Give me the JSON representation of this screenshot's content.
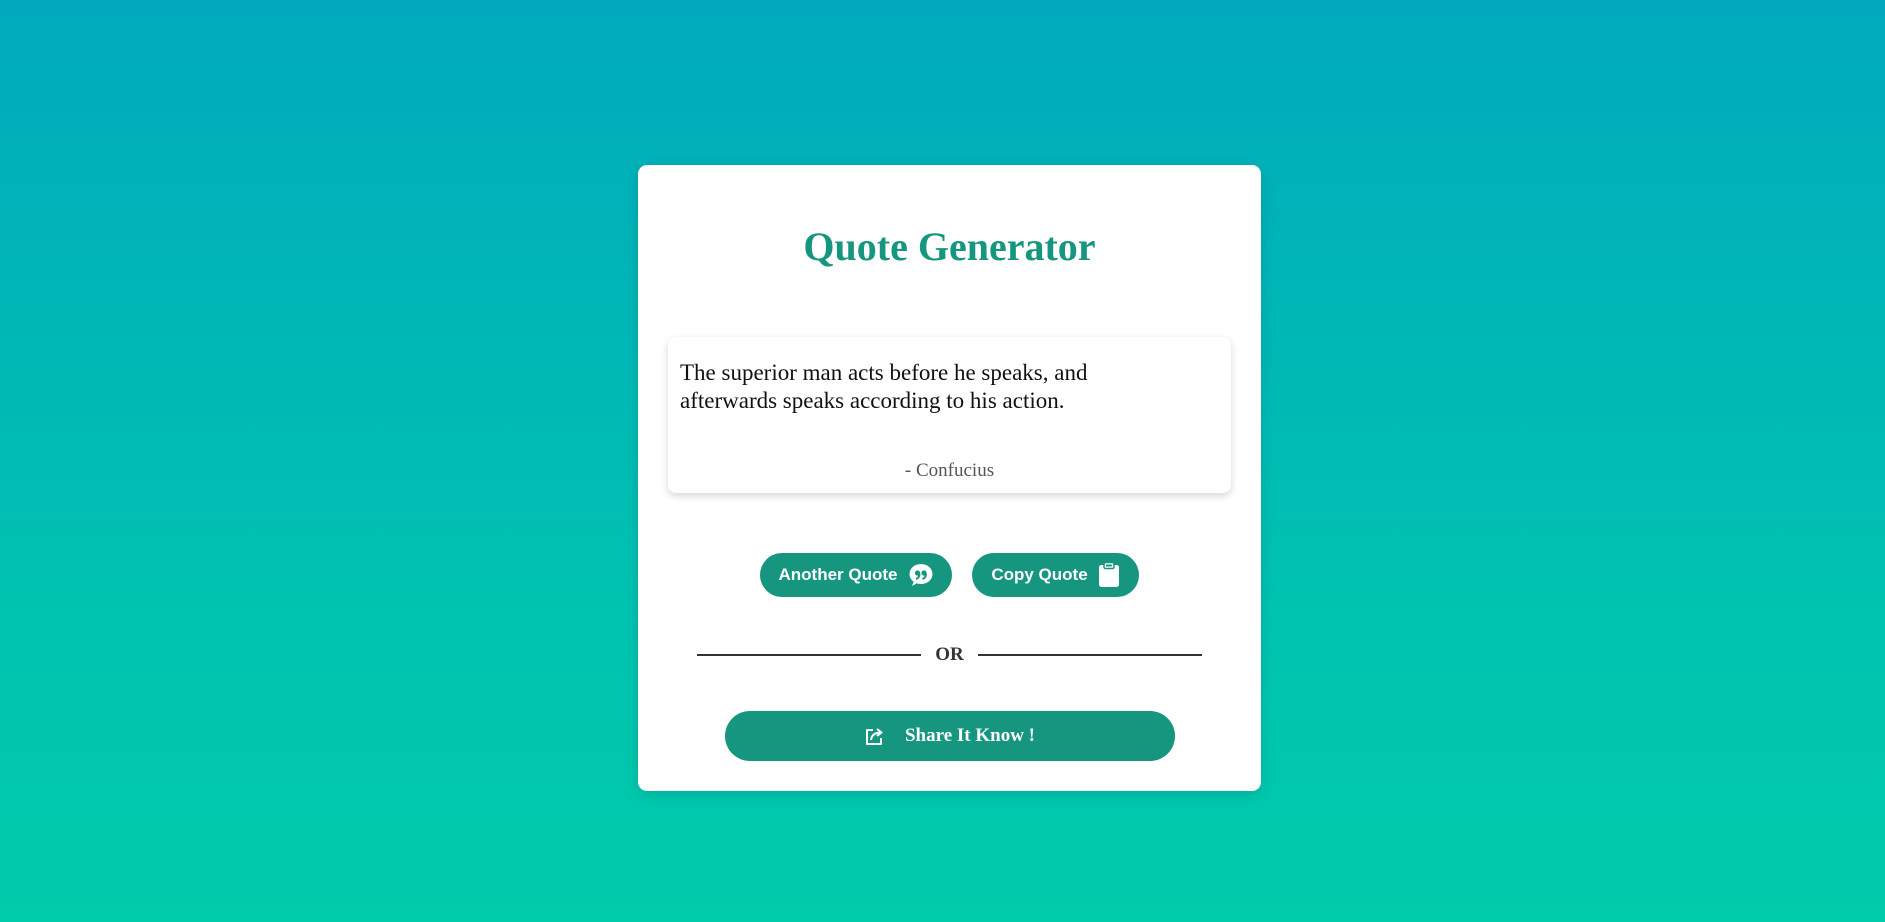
{
  "app": {
    "title": "Quote Generator"
  },
  "quote": {
    "text": "The superior man acts before he speaks, and afterwards speaks according to his action.",
    "author": "- Confucius"
  },
  "actions": {
    "another_quote_label": "Another Quote",
    "another_quote_icon": "quote-bubble-icon",
    "copy_quote_label": "Copy Quote",
    "copy_quote_icon": "clipboard-icon"
  },
  "divider": {
    "label": "OR"
  },
  "share": {
    "label": "Share It Know !",
    "icon": "share-icon"
  },
  "colors": {
    "accent": "#16967f",
    "background_top": "#00aabd",
    "background_bottom": "#00cbaa",
    "card": "#ffffff"
  }
}
